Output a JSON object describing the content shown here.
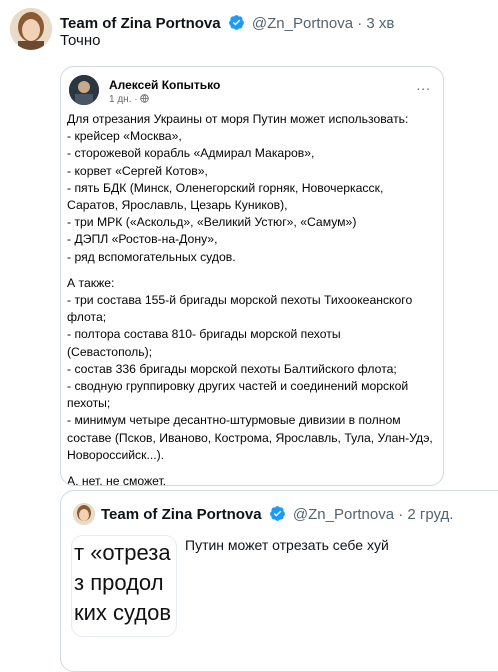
{
  "tweet": {
    "author_name": "Team of Zina Portnova",
    "handle": "@Zn_Portnova",
    "separator": "·",
    "time": "3 хв",
    "text": "Точно"
  },
  "quoted_post": {
    "author": "Алексей Копытько",
    "time": "1 дн.",
    "meta_separator": "·",
    "more": "...",
    "lines": [
      "Для отрезания Украины от моря Путин может использовать:",
      "- крейсер «Москва»,",
      "- сторожевой корабль «Адмирал Макаров»,",
      "- корвет «Сергей Котов»,",
      "- пять БДК (Минск, Оленегорский горняк, Новочеркасск,",
      "Саратов, Ярославль, Цезарь Куников),",
      "- три МРК («Аскольд», «Великий Устюг», «Самум»)",
      "- ДЭПЛ «Ростов-на-Дону»,",
      "- ряд вспомогательных судов."
    ],
    "lines2": [
      "А также:",
      "- три состава 155-й бригады морской пехоты Тихоокеанского",
      "флота;",
      "- полтора состава 810- бригады морской пехоты",
      "(Севастополь);",
      "- состав 336 бригады морской пехоты Балтийского флота;",
      "- сводную группировку других частей и соединений морской",
      "пехоты;",
      "- минимум четыре десантно-штурмовые дивизии в полном",
      "составе (Псков, Иваново, Кострома, Ярославль, Тула, Улан-Удэ,",
      "Новороссийск...)."
    ],
    "closing": "А, нет, не сможет."
  },
  "quoted_tweet": {
    "author_name": "Team of Zina Portnova",
    "handle": "@Zn_Portnova",
    "separator": "·",
    "time": "2 груд.",
    "text": "Путин может отрезать себе хуй",
    "thumb_lines": [
      "т «отреза",
      "з продол",
      "ких судов"
    ]
  },
  "colors": {
    "verified": "#1d9bf0",
    "border": "#cfd9de",
    "secondary_text": "#536471"
  }
}
